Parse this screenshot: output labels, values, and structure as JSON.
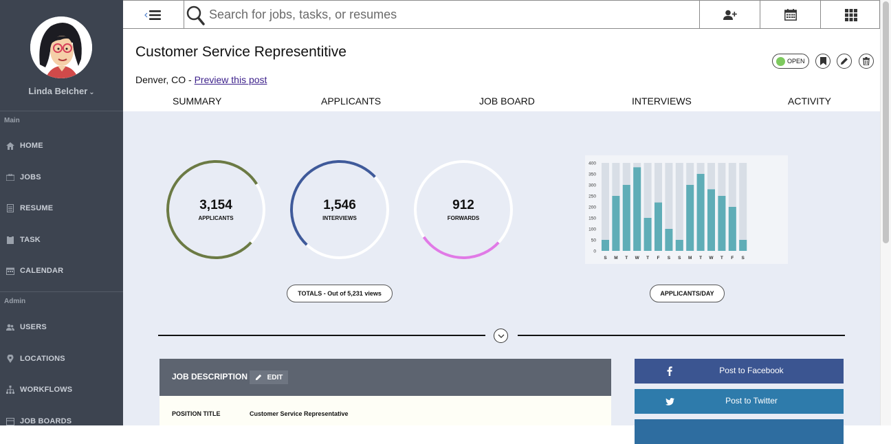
{
  "user": {
    "name": "Linda Belcher"
  },
  "sidebar": {
    "main_label": "Main",
    "admin_label": "Admin",
    "main_items": [
      {
        "label": "HOME",
        "icon": "home-icon"
      },
      {
        "label": "JOBS",
        "icon": "briefcase-icon"
      },
      {
        "label": "RESUME",
        "icon": "document-icon"
      },
      {
        "label": "TASK",
        "icon": "clipboard-icon"
      },
      {
        "label": "CALENDAR",
        "icon": "calendar-icon"
      }
    ],
    "admin_items": [
      {
        "label": "USERS",
        "icon": "users-icon"
      },
      {
        "label": "LOCATIONS",
        "icon": "map-pin-icon"
      },
      {
        "label": "WORKFLOWS",
        "icon": "sitemap-icon"
      },
      {
        "label": "JOB BOARDS",
        "icon": "board-icon"
      }
    ]
  },
  "search": {
    "placeholder": "Search for jobs, tasks, or resumes"
  },
  "job": {
    "title": "Customer Service Representitive",
    "location": "Denver, CO - ",
    "preview_link": "Preview this post",
    "status": "OPEN"
  },
  "tabs": [
    "SUMMARY",
    "APPLICANTS",
    "JOB BOARD",
    "INTERVIEWS",
    "ACTIVITY"
  ],
  "stats": [
    {
      "value": "3,154",
      "label": "APPLICANTS",
      "color": "#6b7a44"
    },
    {
      "value": "1,546",
      "label": "INTERVIEWS",
      "color": "#3f5a9a"
    },
    {
      "value": "912",
      "label": "FORWARDS",
      "color": "#e07ae6"
    }
  ],
  "totals_pill": "TOTALS - Out of 5,231 views",
  "chart_pill": "APPLICANTS/DAY",
  "chart_data": {
    "type": "bar",
    "categories": [
      "S",
      "M",
      "T",
      "W",
      "T",
      "F",
      "S",
      "S",
      "M",
      "T",
      "W",
      "T",
      "F",
      "S"
    ],
    "values": [
      50,
      250,
      300,
      380,
      150,
      220,
      100,
      50,
      300,
      350,
      280,
      250,
      200,
      50
    ],
    "ylim": [
      0,
      400
    ],
    "yticks": [
      0,
      50,
      100,
      150,
      200,
      250,
      300,
      350,
      400
    ],
    "title": "",
    "xlabel": "",
    "ylabel": "",
    "bar_color": "#5fadb7",
    "track_color": "#d8dee6"
  },
  "job_description": {
    "heading": "JOB DESCRIPTION",
    "edit_label": "EDIT",
    "rows": [
      {
        "label": "POSITION TITLE",
        "value": "Customer Service Representative"
      }
    ]
  },
  "social": [
    {
      "label": "Post to Facebook",
      "icon": "facebook-icon",
      "color": "#3b5591"
    },
    {
      "label": "Post to Twitter",
      "icon": "twitter-icon",
      "color": "#2e7bab"
    }
  ]
}
